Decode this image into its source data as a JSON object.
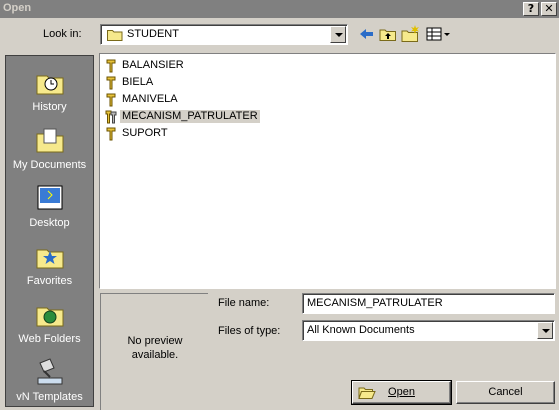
{
  "window": {
    "title": "Open",
    "help_glyph": "?",
    "close_glyph": "✕"
  },
  "lookin": {
    "label": "Look in:",
    "value": "STUDENT"
  },
  "toolbar": {
    "icons": [
      "back-arrow-icon",
      "up-folder-icon",
      "new-folder-icon",
      "views-menu-icon"
    ]
  },
  "places": [
    {
      "label": "History",
      "icon": "history-folder-icon"
    },
    {
      "label": "My Documents",
      "icon": "my-documents-folder-icon"
    },
    {
      "label": "Desktop",
      "icon": "desktop-icon"
    },
    {
      "label": "Favorites",
      "icon": "favorites-folder-icon"
    },
    {
      "label": "Web Folders",
      "icon": "web-folders-icon"
    },
    {
      "label": "vN Templates",
      "icon": "vn-templates-icon"
    }
  ],
  "files": [
    {
      "name": "BALANSIER",
      "icon": "part-file-icon",
      "selected": false
    },
    {
      "name": "BIELA",
      "icon": "part-file-icon",
      "selected": false
    },
    {
      "name": "MANIVELA",
      "icon": "part-file-icon",
      "selected": false
    },
    {
      "name": "MECANISM_PATRULATER",
      "icon": "assembly-file-icon",
      "selected": true
    },
    {
      "name": "SUPORT",
      "icon": "part-file-icon",
      "selected": false
    }
  ],
  "preview": {
    "line1": "No preview",
    "line2": "available."
  },
  "filename": {
    "label": "File name:",
    "value": "MECANISM_PATRULATER"
  },
  "filetype": {
    "label": "Files of type:",
    "value": "All Known Documents"
  },
  "buttons": {
    "open_label": "Open",
    "cancel_label": "Cancel"
  }
}
